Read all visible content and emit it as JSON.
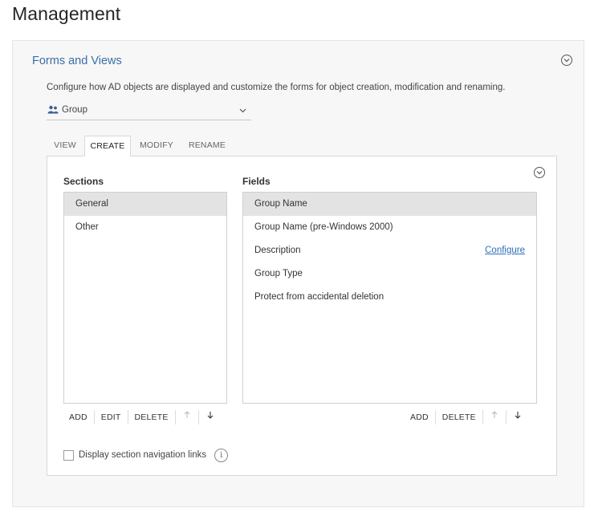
{
  "page": {
    "title": "Management"
  },
  "panel": {
    "title": "Forms and Views",
    "description": "Configure how AD objects are displayed and customize the forms for object creation, modification and renaming.",
    "collapse_icon": "chevron-circle-icon"
  },
  "object_selector": {
    "icon": "group-icon",
    "value": "Group"
  },
  "tabs": [
    {
      "label": "VIEW",
      "active": false
    },
    {
      "label": "CREATE",
      "active": true
    },
    {
      "label": "MODIFY",
      "active": false
    },
    {
      "label": "RENAME",
      "active": false
    }
  ],
  "sections": {
    "heading": "Sections",
    "items": [
      {
        "label": "General",
        "selected": true
      },
      {
        "label": "Other",
        "selected": false
      }
    ],
    "toolbar": {
      "add": "ADD",
      "edit": "EDIT",
      "delete": "DELETE"
    }
  },
  "fields": {
    "heading": "Fields",
    "items": [
      {
        "label": "Group Name",
        "selected": true
      },
      {
        "label": "Group Name (pre-Windows 2000)",
        "selected": false
      },
      {
        "label": "Description",
        "selected": false,
        "link": "Configure"
      },
      {
        "label": "Group Type",
        "selected": false
      },
      {
        "label": "Protect from accidental deletion",
        "selected": false
      }
    ],
    "toolbar": {
      "add": "ADD",
      "delete": "DELETE"
    }
  },
  "options": {
    "nav_links_label": "Display section navigation links",
    "nav_links_checked": false,
    "info_icon": "info-icon"
  },
  "colors": {
    "link": "#2d6db5",
    "panel_title": "#3a6ea5",
    "selected_row": "#e3e3e3"
  }
}
